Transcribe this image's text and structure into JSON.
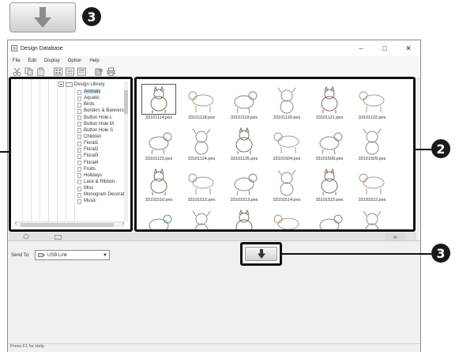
{
  "callouts": {
    "badge_top": "3",
    "badge_grid": "2",
    "badge_arrow": "3"
  },
  "window": {
    "title": "Design Database",
    "controls": [
      "–",
      "□",
      "✕"
    ],
    "menu": [
      "File",
      "Edit",
      "Display",
      "Option",
      "Help"
    ],
    "toolbar_icons": [
      "cut-icon",
      "copy-icon",
      "paste-icon",
      "large-icons-view-icon",
      "list-view-icon",
      "details-view-icon",
      "write-to-card-icon",
      "print-icon"
    ]
  },
  "tree": {
    "root": "Design Library",
    "items": [
      "Animals",
      "Aquatic",
      "Birds",
      "Borders & Banners",
      "Button Hole L",
      "Button Hole M",
      "Button Hole S",
      "Children",
      "Floral1",
      "Floral2",
      "Floral3",
      "Floral4",
      "Fruits",
      "Holidays",
      "Lace & Ribbon",
      "Misc",
      "Monogram Decorati",
      "Music"
    ],
    "selected_index": 0
  },
  "grid": {
    "files": [
      "33101114.pes",
      "33101118.pes",
      "33101119.pes",
      "33101120.pes",
      "33101121.pes",
      "33101122.pes",
      "33101123.pes",
      "33101124.pes",
      "33101125.pes",
      "33101504.pes",
      "33101508.pes",
      "33101509.pes",
      "33101510.pes",
      "33101512.pes",
      "33101513.pes",
      "33101514.pes",
      "33101515.pes",
      "33101522.pes",
      "",
      "",
      "",
      "",
      "",
      ""
    ],
    "selected_index": 0
  },
  "bottom": {
    "send_to_label": "Send To:",
    "send_to_value": "USB Link",
    "status": "Press F1 for Help"
  },
  "colors": {
    "frame": "#111111",
    "selection": "#cfe3f7"
  }
}
